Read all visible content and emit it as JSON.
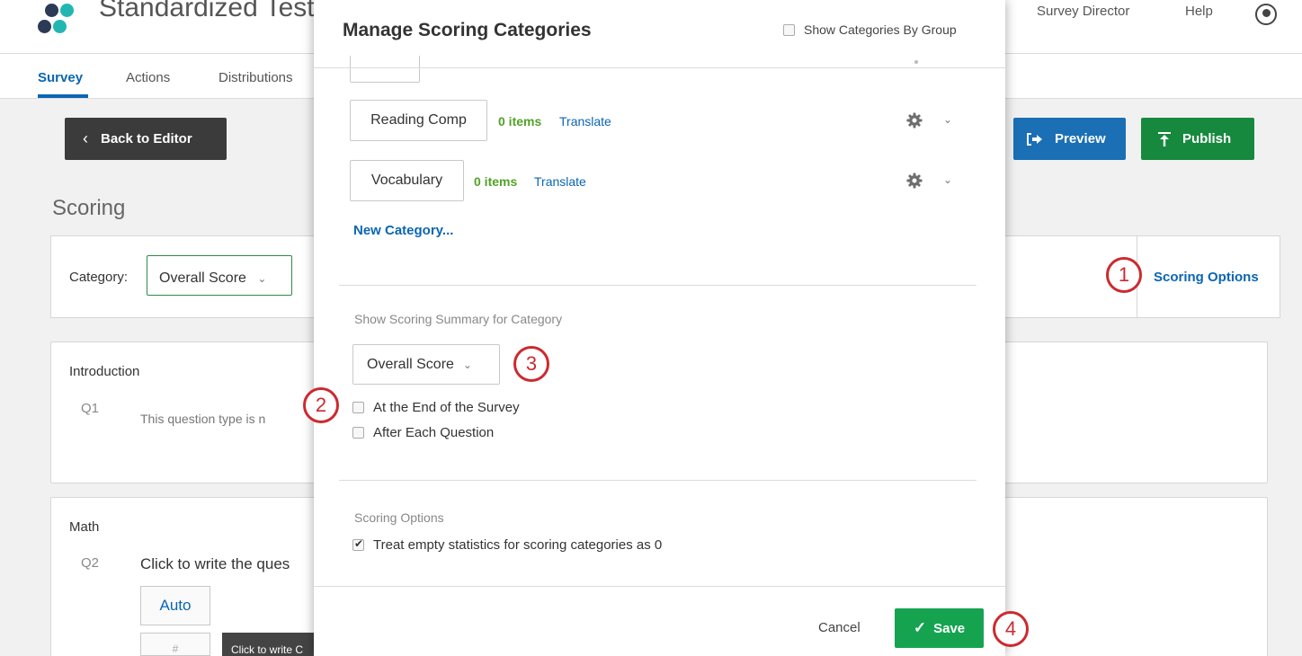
{
  "app": {
    "title": "Standardized Test F",
    "top_links": [
      "Survey Director",
      "Help"
    ]
  },
  "nav": {
    "tabs": [
      {
        "label": "Survey",
        "active": true
      },
      {
        "label": "Actions",
        "active": false
      },
      {
        "label": "Distributions",
        "active": false
      }
    ]
  },
  "toolbar": {
    "back_label": "Back to Editor",
    "preview_label": "Preview",
    "publish_label": "Publish"
  },
  "page": {
    "heading": "Scoring",
    "category_label": "Category:",
    "category_value": "Overall Score",
    "scoring_options_link": "Scoring Options"
  },
  "blocks": [
    {
      "title": "Introduction",
      "question": {
        "number": "Q1",
        "text": "This question type is n"
      }
    },
    {
      "title": "Math",
      "question": {
        "number": "Q2",
        "text": "Click to write the ques"
      },
      "auto_label": "Auto",
      "input_placeholder": "#",
      "tooltip": "Click to write C"
    }
  ],
  "modal": {
    "title": "Manage Scoring Categories",
    "show_by_group_label": "Show Categories By Group",
    "show_by_group_checked": false,
    "categories": [
      {
        "name": "Reading Comp",
        "count": "0 items",
        "translate": "Translate"
      },
      {
        "name": "Vocabulary",
        "count": "0 items",
        "translate": "Translate"
      }
    ],
    "new_category_label": "New Category...",
    "summary_section_label": "Show Scoring Summary for Category",
    "summary_select_value": "Overall Score",
    "summary_options": [
      {
        "label": "At the End of the Survey",
        "checked": false
      },
      {
        "label": "After Each Question",
        "checked": false
      }
    ],
    "scoring_options_label": "Scoring Options",
    "treat_empty_label": "Treat empty statistics for scoring categories as 0",
    "treat_empty_checked": true,
    "cancel_label": "Cancel",
    "save_label": "Save"
  },
  "annotations": [
    "1",
    "2",
    "3",
    "4"
  ],
  "colors": {
    "link_blue": "#0b66b2",
    "count_green": "#52a128",
    "save_green": "#15a350",
    "publish_green": "#17893e",
    "preview_blue": "#1a6fb5",
    "marker_red": "#cc2a2f",
    "logo_dark": "#2b3a55",
    "logo_teal": "#22b6b3"
  },
  "icons": [
    "logo-icon",
    "avatar-icon",
    "chevron-left-icon",
    "preview-icon",
    "publish-icon",
    "gear-icon",
    "chevron-down-icon",
    "checkbox-icon",
    "checkmark-icon"
  ]
}
